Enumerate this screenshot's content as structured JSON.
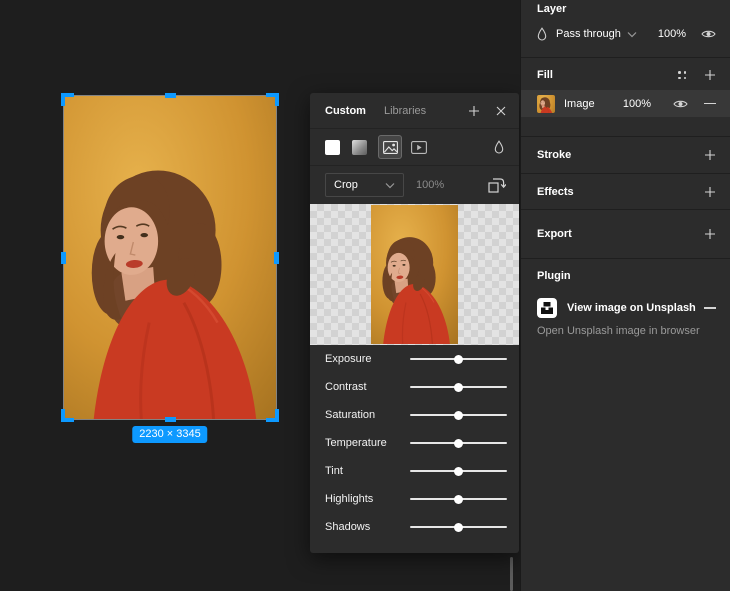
{
  "colors": {
    "accent": "#0d99ff",
    "canvas_bg": "#1e1e1e",
    "panel_bg": "#2c2c2c",
    "highlight_row": "#383838"
  },
  "canvas": {
    "selection_badge": "2230 × 3345"
  },
  "plugin_panel": {
    "tabs": {
      "custom": "Custom",
      "libraries": "Libraries"
    },
    "fill_types": [
      "solid",
      "gradient",
      "image",
      "video"
    ],
    "selected_fill_type": "image",
    "crop": {
      "mode": "Crop",
      "opacity": "100%"
    },
    "sliders": [
      {
        "label": "Exposure",
        "position_pct": 50
      },
      {
        "label": "Contrast",
        "position_pct": 50
      },
      {
        "label": "Saturation",
        "position_pct": 50
      },
      {
        "label": "Temperature",
        "position_pct": 50
      },
      {
        "label": "Tint",
        "position_pct": 50
      },
      {
        "label": "Highlights",
        "position_pct": 50
      },
      {
        "label": "Shadows",
        "position_pct": 50
      }
    ]
  },
  "inspector": {
    "layer": {
      "title": "Layer",
      "blend_mode": "Pass through",
      "opacity": "100%"
    },
    "fill": {
      "title": "Fill",
      "item": {
        "type": "Image",
        "opacity": "100%"
      }
    },
    "stroke": {
      "title": "Stroke"
    },
    "effects": {
      "title": "Effects"
    },
    "export": {
      "title": "Export"
    },
    "plugin": {
      "title": "Plugin",
      "action_label": "View image on Unsplash",
      "description": "Open Unsplash image in browser"
    }
  }
}
